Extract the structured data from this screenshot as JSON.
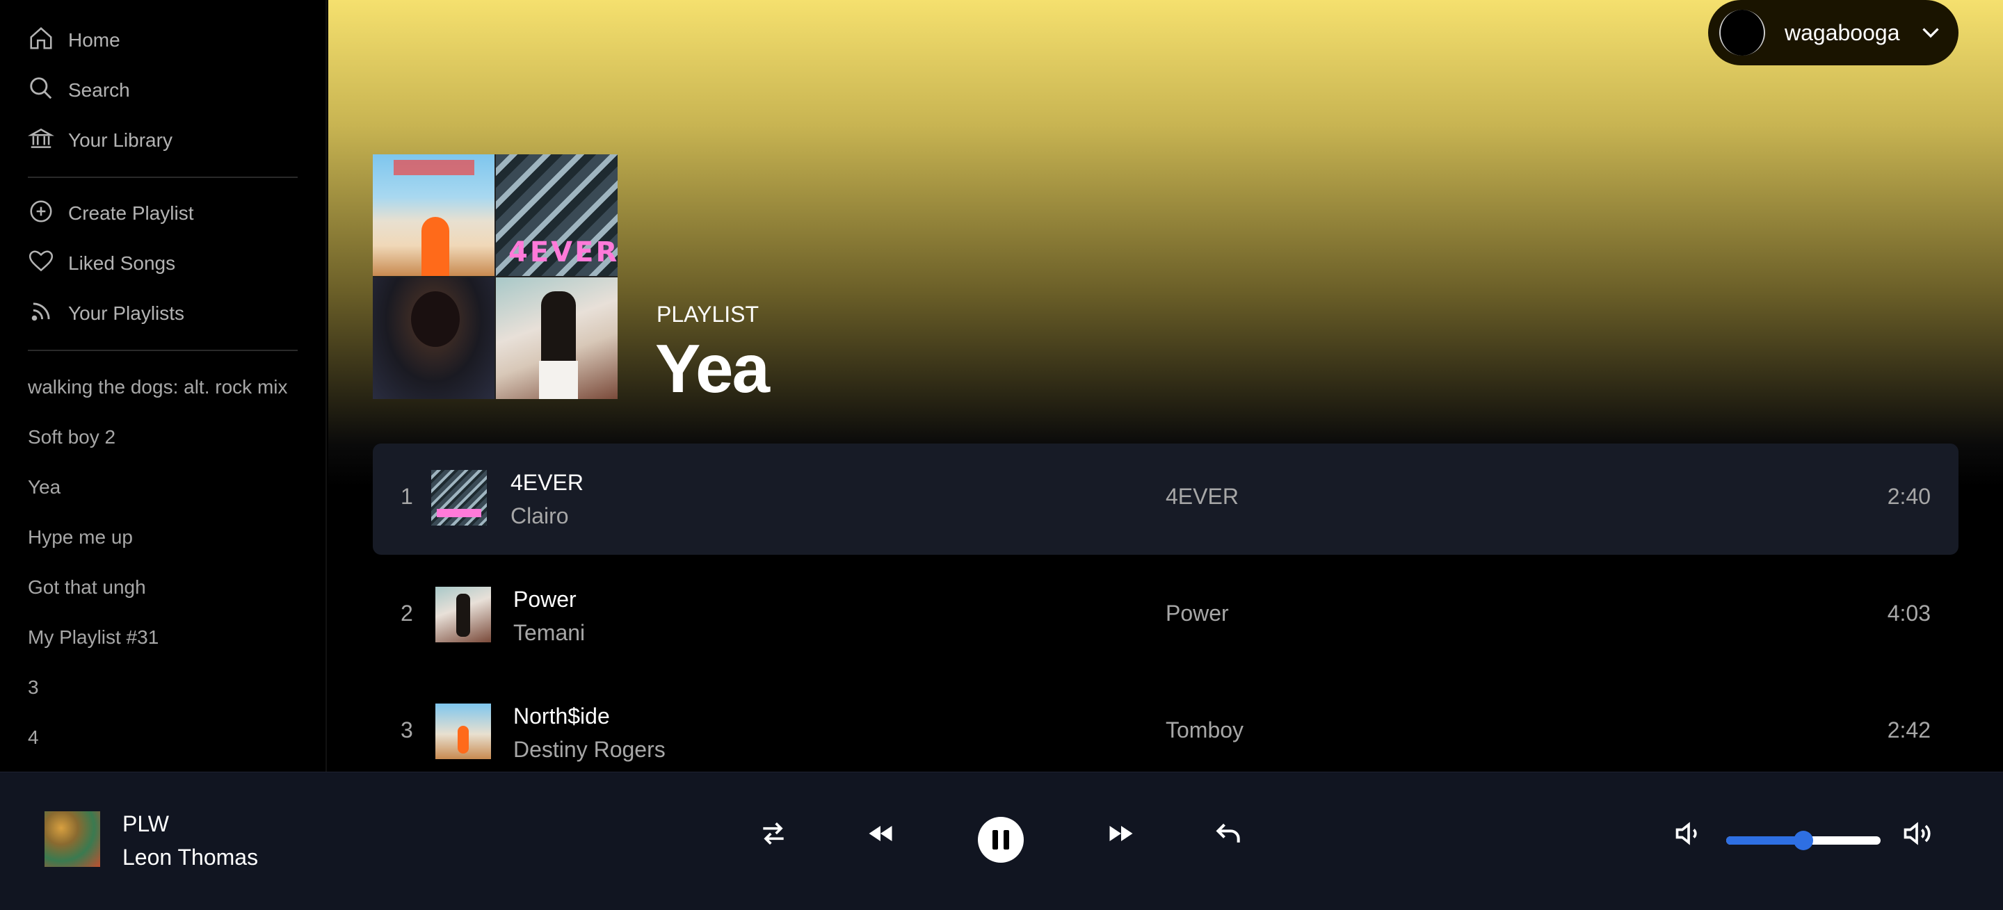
{
  "sidebar": {
    "nav": [
      {
        "label": "Home",
        "icon": "home-icon"
      },
      {
        "label": "Search",
        "icon": "search-icon"
      },
      {
        "label": "Your Library",
        "icon": "library-icon"
      }
    ],
    "actions": [
      {
        "label": "Create Playlist",
        "icon": "plus-circle-icon"
      },
      {
        "label": "Liked Songs",
        "icon": "heart-icon"
      },
      {
        "label": "Your Playlists",
        "icon": "rss-icon"
      }
    ],
    "playlists": [
      "walking the dogs: alt. rock mix",
      "Soft boy 2",
      "Yea",
      "Hype me up",
      "Got that ungh",
      "My Playlist #31",
      "3",
      "4"
    ]
  },
  "header": {
    "user": {
      "name": "wagabooga"
    }
  },
  "playlist": {
    "type": "PLAYLIST",
    "title": "Yea",
    "tracks": [
      {
        "number": "1",
        "name": "4EVER",
        "artist": "Clairo",
        "album": "4EVER",
        "duration": "2:40",
        "active": true
      },
      {
        "number": "2",
        "name": "Power",
        "artist": "Temani",
        "album": "Power",
        "duration": "4:03",
        "active": false
      },
      {
        "number": "3",
        "name": "North$ide",
        "artist": "Destiny Rogers",
        "album": "Tomboy",
        "duration": "2:42",
        "active": false
      }
    ]
  },
  "player": {
    "title": "PLW",
    "artist": "Leon Thomas",
    "volume": 0.5,
    "state": "playing"
  },
  "colors": {
    "accent": "#2e6fe3",
    "header_gradient_top": "#f5e06e",
    "active_row": "#171b26",
    "player_bg": "#111521"
  }
}
